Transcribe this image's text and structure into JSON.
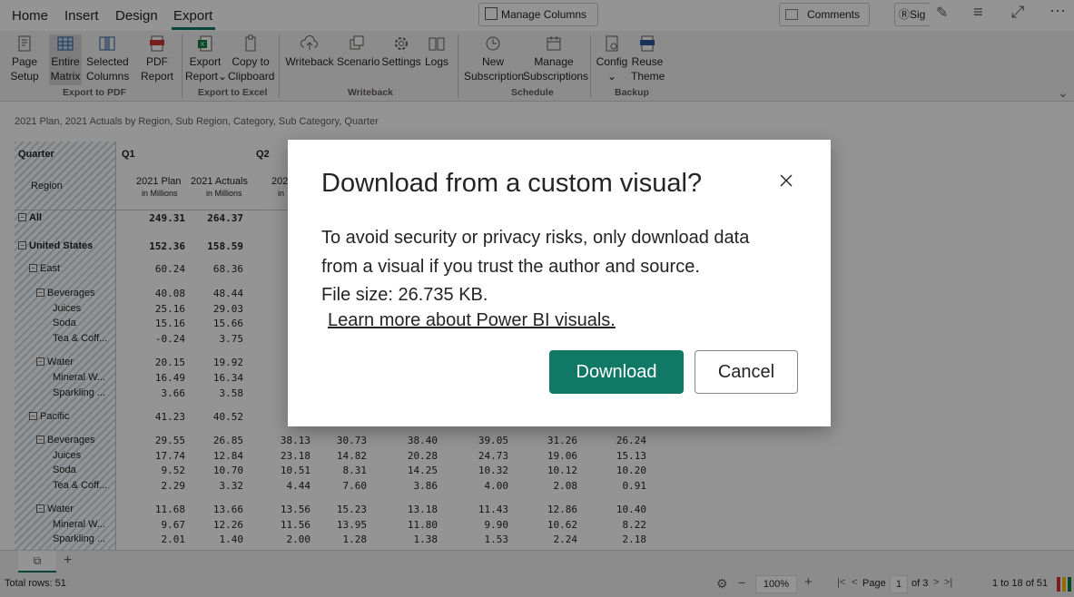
{
  "ribbon_tabs": [
    "Home",
    "Insert",
    "Design",
    "Export"
  ],
  "top_controls": {
    "manage_columns": "Manage Columns",
    "comments": "Comments",
    "sign_in": "Sig"
  },
  "ribbon": {
    "buttons": [
      {
        "l1": "Page",
        "l2": "Setup"
      },
      {
        "l1": "Entire",
        "l2": "Matrix"
      },
      {
        "l1": "Selected",
        "l2": "Columns"
      },
      {
        "l1": "PDF",
        "l2": "Report"
      },
      {
        "l1": "Export",
        "l2": "Report"
      },
      {
        "l1": "Copy to",
        "l2": "Clipboard"
      },
      {
        "l1": "Writeback",
        "l2": ""
      },
      {
        "l1": "Scenario",
        "l2": ""
      },
      {
        "l1": "Settings",
        "l2": ""
      },
      {
        "l1": "Logs",
        "l2": ""
      },
      {
        "l1": "New",
        "l2": "Subscription"
      },
      {
        "l1": "Manage",
        "l2": "Subscriptions"
      },
      {
        "l1": "Config",
        "l2": ""
      },
      {
        "l1": "Reuse",
        "l2": "Theme"
      }
    ],
    "groups": [
      "Export to PDF",
      "Export to Excel",
      "Writeback",
      "Schedule",
      "Backup"
    ]
  },
  "matrix": {
    "title": "2021 Plan, 2021 Actuals by Region, Sub Region, Category, Sub Category, Quarter",
    "quarter_label": "Quarter",
    "region_label": "Region",
    "q1": "Q1",
    "q2": "Q2",
    "col_plan": "2021 Plan",
    "col_actual": "2021 Actuals",
    "col_sub": "in Millions",
    "col_q2_partial": "202",
    "col_q2_sub_partial": "in",
    "rows": [
      {
        "label": "All",
        "v": [
          "249.31",
          "264.37",
          "3"
        ]
      },
      {
        "label": "United States",
        "v": [
          "152.36",
          "158.59",
          "1"
        ]
      },
      {
        "label": "East",
        "v": [
          "60.24",
          "68.36"
        ]
      },
      {
        "label": "Beverages",
        "v": [
          "40.08",
          "48.44"
        ]
      },
      {
        "label": "Juices",
        "v": [
          "25.16",
          "29.03"
        ]
      },
      {
        "label": "Soda",
        "v": [
          "15.16",
          "15.66"
        ]
      },
      {
        "label": "Tea & Coff...",
        "v": [
          "-0.24",
          "3.75"
        ]
      },
      {
        "label": "Water",
        "v": [
          "20.15",
          "19.92"
        ]
      },
      {
        "label": "Mineral W...",
        "v": [
          "16.49",
          "16.34"
        ]
      },
      {
        "label": "Sparkling ...",
        "v": [
          "3.66",
          "3.58"
        ]
      },
      {
        "label": "Pacific",
        "v": [
          "41.23",
          "40.52"
        ]
      },
      {
        "label": "Beverages",
        "v": [
          "29.55",
          "26.85",
          "38.13",
          "30.73",
          "38.40",
          "39.05",
          "31.26",
          "26.24"
        ]
      },
      {
        "label": "Juices",
        "v": [
          "17.74",
          "12.84",
          "23.18",
          "14.82",
          "20.28",
          "24.73",
          "19.06",
          "15.13"
        ]
      },
      {
        "label": "Soda",
        "v": [
          "9.52",
          "10.70",
          "10.51",
          "8.31",
          "14.25",
          "10.32",
          "10.12",
          "10.20"
        ]
      },
      {
        "label": "Tea & Coff...",
        "v": [
          "2.29",
          "3.32",
          "4.44",
          "7.60",
          "3.86",
          "4.00",
          "2.08",
          "0.91"
        ]
      },
      {
        "label": "Water",
        "v": [
          "11.68",
          "13.66",
          "13.56",
          "15.23",
          "13.18",
          "11.43",
          "12.86",
          "10.40"
        ]
      },
      {
        "label": "Mineral W...",
        "v": [
          "9.67",
          "12.26",
          "11.56",
          "13.95",
          "11.80",
          "9.90",
          "10.62",
          "8.22"
        ]
      },
      {
        "label": "Sparkling ...",
        "v": [
          "2.01",
          "1.40",
          "2.00",
          "1.28",
          "1.38",
          "1.53",
          "2.24",
          "2.18"
        ]
      }
    ]
  },
  "dialog": {
    "title": "Download from a custom visual?",
    "body_line1": "To avoid security or privacy risks, only download data",
    "body_line2": "from a visual if you trust the author and source.",
    "file_size": "File size: 26.735 KB.",
    "link": "Learn more about Power BI visuals.",
    "download": "Download",
    "cancel": "Cancel"
  },
  "status": {
    "total_rows": "Total rows: 51",
    "zoom": "100%",
    "page_label": "Page",
    "page_value": "1",
    "page_of": "of 3",
    "range": "1 to 18 of 51"
  },
  "colors": {
    "accent": "#117865",
    "hatch": "#c5dbea"
  }
}
